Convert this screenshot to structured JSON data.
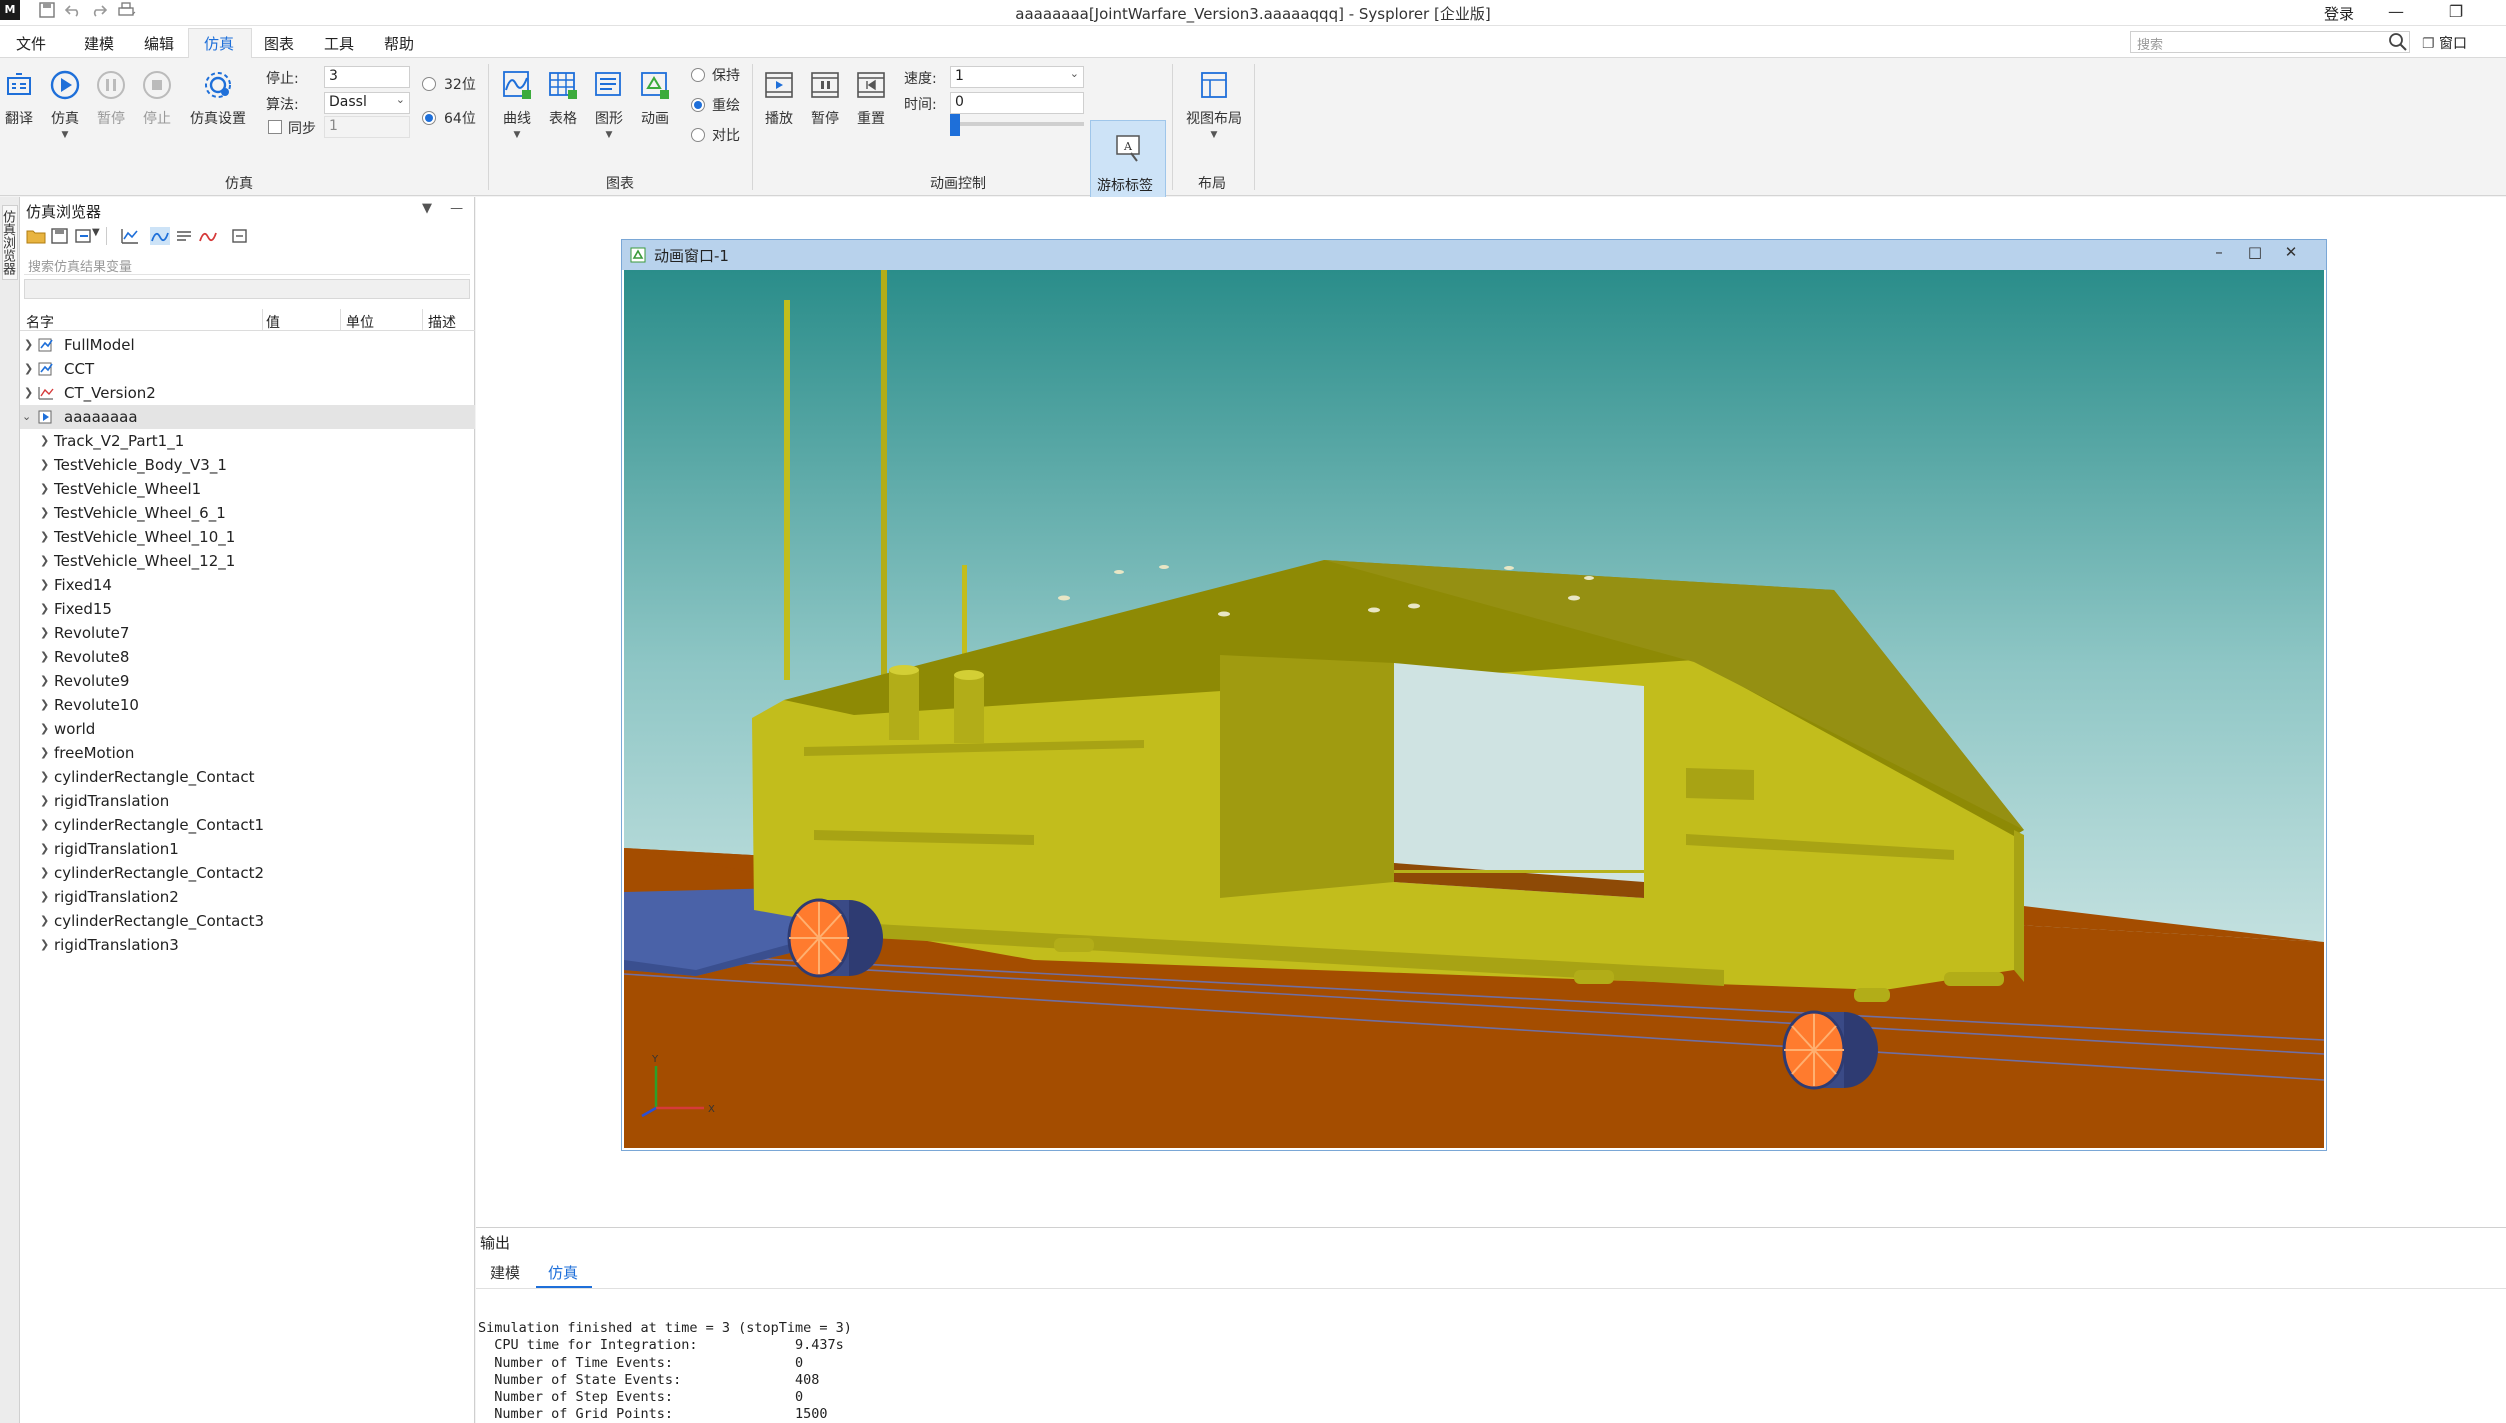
{
  "titlebar": {
    "title": "aaaaaaaa[JointWarfare_Version3.aaaaaqqq] - Sysplorer [企业版]",
    "login": "登录",
    "logo": "M",
    "quick_access": [
      "save-icon",
      "undo-icon",
      "redo-icon",
      "print-icon"
    ]
  },
  "menubar": {
    "items": [
      "文件",
      "建模",
      "编辑",
      "仿真",
      "图表",
      "工具",
      "帮助"
    ],
    "active": "仿真",
    "search_placeholder": "搜索",
    "window_label": "窗口"
  },
  "ribbon": {
    "sim_group": {
      "label": "仿真",
      "translate": "翻译",
      "simulate": "仿真",
      "pause": "暂停",
      "stop": "停止",
      "settings": "仿真设置",
      "stop_time_label": "停止:",
      "stop_time_value": "3",
      "algorithm_label": "算法:",
      "algorithm_value": "Dassl",
      "sync_label": "同步",
      "sync_value": "1",
      "bit32_label": "32位",
      "bit64_label": "64位",
      "selected_bits": "64位"
    },
    "chart_group": {
      "label": "图表",
      "curve": "曲线",
      "table": "表格",
      "graphic": "图形",
      "animation": "动画",
      "keep": "保持",
      "redraw": "重绘",
      "compare": "对比",
      "selected_mode": "重绘"
    },
    "anim_group": {
      "label": "动画控制",
      "play": "播放",
      "pause": "暂停",
      "reset": "重置",
      "speed_label": "速度:",
      "speed_value": "1",
      "time_label": "时间:",
      "time_value": "0",
      "time_slider_position": 0.0,
      "cursor_tag": "游标标签"
    },
    "layout_group": {
      "label": "布局",
      "view_layout": "视图布局"
    }
  },
  "sidestrip": {
    "tab_label": "仿真浏览器"
  },
  "browser": {
    "title": "仿真浏览器",
    "search_placeholder": "搜索仿真结果变量",
    "columns": [
      "名字",
      "值",
      "单位",
      "描述"
    ],
    "top_items": [
      {
        "label": "FullModel",
        "expanded": false
      },
      {
        "label": "CCT",
        "expanded": false
      },
      {
        "label": "CT_Version2",
        "expanded": false
      },
      {
        "label": "aaaaaaaa",
        "expanded": true,
        "selected": true
      }
    ],
    "children": [
      "Track_V2_Part1_1",
      "TestVehicle_Body_V3_1",
      "TestVehicle_Wheel1",
      "TestVehicle_Wheel_6_1",
      "TestVehicle_Wheel_10_1",
      "TestVehicle_Wheel_12_1",
      "Fixed14",
      "Fixed15",
      "Revolute7",
      "Revolute8",
      "Revolute9",
      "Revolute10",
      "world",
      "freeMotion",
      "cylinderRectangle_Contact",
      "rigidTranslation",
      "cylinderRectangle_Contact1",
      "rigidTranslation1",
      "cylinderRectangle_Contact2",
      "rigidTranslation2",
      "cylinderRectangle_Contact3",
      "rigidTranslation3"
    ]
  },
  "animation_window": {
    "title": "动画窗口-1",
    "axis_labels": {
      "x": "X",
      "y": "Y"
    },
    "colors": {
      "sky_top": "#2a8d8a",
      "sky_bottom": "#e8f2f2",
      "ground": "#a44d00",
      "body": "#c2bd1c",
      "wheel": "#ff7b2e",
      "platform": "#4a62a8"
    }
  },
  "output": {
    "label": "输出",
    "tabs": [
      "建模",
      "仿真"
    ],
    "active_tab": "仿真",
    "lines": [
      "Simulation finished at time = 3 (stopTime = 3)",
      "  CPU time for Integration:            9.437s",
      "  Number of Time Events:               0",
      "  Number of State Events:              408",
      "  Number of Step Events:               0",
      "  Number of Grid Points:               1500"
    ]
  }
}
